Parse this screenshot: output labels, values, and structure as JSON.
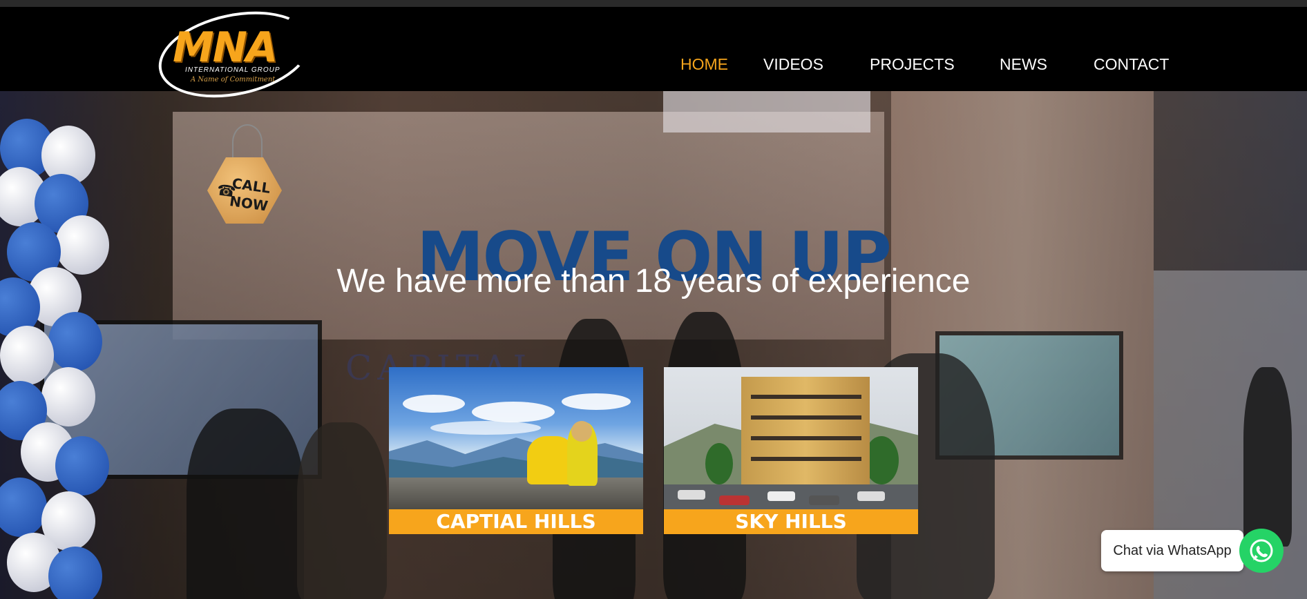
{
  "brand": {
    "logo_text": "MNA",
    "logo_subtitle": "INTERNATIONAL GROUP",
    "logo_tagline": "A Name of Commitment"
  },
  "nav": {
    "items": [
      {
        "label": "HOME",
        "active": true
      },
      {
        "label": "VIDEOS",
        "active": false
      },
      {
        "label": "PROJECTS",
        "active": false
      },
      {
        "label": "NEWS",
        "active": false
      },
      {
        "label": "CONTACT",
        "active": false
      }
    ]
  },
  "call_now": {
    "label_line1": "CALL",
    "label_line2": "NOW"
  },
  "hero": {
    "title": "MOVE ON UP",
    "subtitle": "We have more than 18 years of experience",
    "background_sign": "CAPITAL"
  },
  "projects": [
    {
      "label": "CAPTIAL HILLS"
    },
    {
      "label": "SKY HILLS"
    }
  ],
  "whatsapp": {
    "label": "Chat via WhatsApp"
  },
  "colors": {
    "accent": "#f7a51c",
    "title_blue": "#174a8a",
    "whatsapp_green": "#25d366"
  }
}
